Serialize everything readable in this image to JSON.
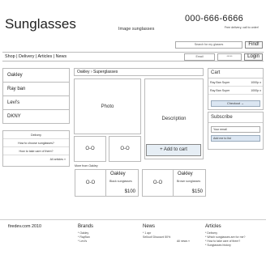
{
  "header": {
    "brand": "Sunglasses",
    "tagline": "Image sunglasses",
    "phone": "000-666-6666",
    "free_delivery": "Free delivery, call to order!",
    "search_placeholder": "Search for my glasses",
    "find_label": "Find!",
    "email_placeholder": "Email",
    "password_placeholder": "*****",
    "login_label": "Login"
  },
  "nav": {
    "links_text": "Shop | Delivery | Articles | News"
  },
  "left_nav": {
    "items": [
      "Oakley",
      "Ray ban",
      "Levi's",
      "DKNY"
    ]
  },
  "help": {
    "items": [
      "Delivery",
      "How to choose sunglasses?",
      "How to take care of them?",
      "All articles »"
    ]
  },
  "product": {
    "breadcrumb": "Oakley › Superglasses",
    "photo_label": "Photo",
    "description_label": "Description",
    "thumb1": "O-O",
    "thumb2": "O-O",
    "add_to_cart": "+ Add to cart",
    "more_from": "More from Oakley"
  },
  "related": [
    {
      "thumb": "O-O",
      "name": "Oakley",
      "desc": "Black sunglasses",
      "price": "$100"
    },
    {
      "thumb": "O-O",
      "name": "Oakley",
      "desc": "Brown sunglasses",
      "price": "$150"
    }
  ],
  "cart": {
    "title": "Cart",
    "rows": [
      {
        "name": "Ray Ban Super",
        "amount": "1000p x"
      },
      {
        "name": "Ray Ban Super",
        "amount": "1000p x"
      }
    ],
    "checkout": "Checkout →"
  },
  "subscribe": {
    "title": "Subscribe",
    "email_placeholder": "Your email",
    "add_button": "Add me to list"
  },
  "footer": {
    "copyright": "firedev.com 2010",
    "brands_title": "Brands",
    "brands": [
      "* Oakley",
      "* RayBan",
      "* Levi's"
    ],
    "news_title": "News",
    "news": [
      "* 1 apr",
      "Sellout! Discount 50%",
      "All news »"
    ],
    "articles_title": "Articles",
    "articles": [
      "* Delivery",
      "* Which sunglasses are for me?",
      "* How to take care of them?",
      "* Sunglasses history"
    ]
  }
}
